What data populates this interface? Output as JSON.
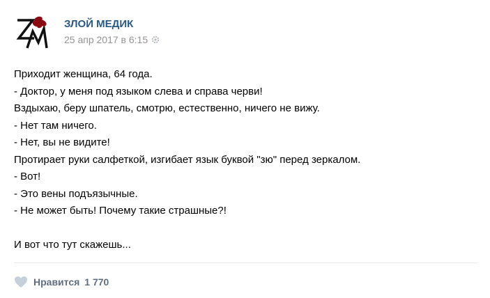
{
  "post": {
    "author": "ЗЛОЙ МЕДИК",
    "date": "25 апр 2017 в 6:15",
    "lines": [
      "Приходит женщина, 64 года.",
      "- Доктор, у меня под языком слева и справа черви!",
      "Вздыхаю, беру шпатель, смотрю, естественно, ничего не вижу.",
      "- Нет там ничего.",
      "- Нет, вы не видите!",
      "Протирает руки салфеткой, изгибает язык буквой \"зю\" перед зеркалом.",
      "- Вот!",
      "- Это вены подъязычные.",
      "- Не может быть! Почему такие страшные?!",
      "",
      "И вот что тут скажешь..."
    ]
  },
  "likes": {
    "label": "Нравится",
    "count": "1 770"
  },
  "colors": {
    "author": "#2a5885",
    "date": "#939393",
    "likes": "#5e6d80",
    "heart": "#c5d0db",
    "logo_red": "#8b0a12"
  },
  "icons": {
    "avatar": "zm-logo",
    "settings": "gear-icon",
    "like": "heart-icon"
  }
}
